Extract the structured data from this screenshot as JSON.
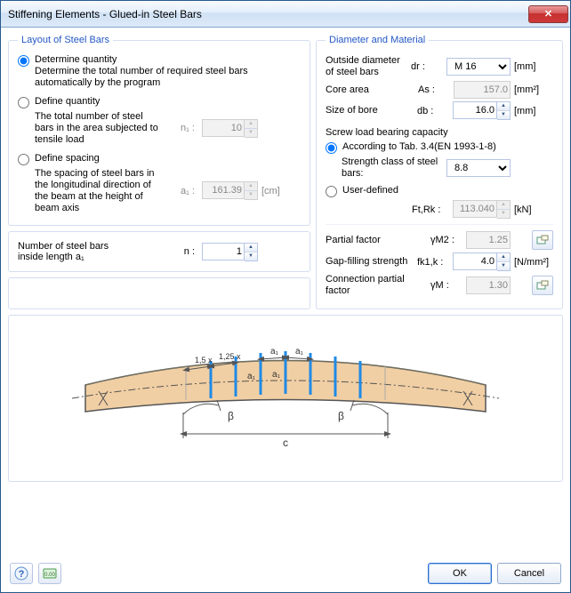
{
  "window": {
    "title": "Stiffening Elements - Glued-in Steel Bars",
    "close_glyph": "✕"
  },
  "layout_group": {
    "legend": "Layout of Steel Bars",
    "opt1": {
      "title": "Determine quantity",
      "desc": "Determine the total number of required steel bars automatically by the program"
    },
    "opt2": {
      "title": "Define quantity",
      "desc": "The total number of steel bars in the area subjected to tensile load",
      "sym": "n₁ :",
      "value": "10"
    },
    "opt3": {
      "title": "Define spacing",
      "desc": "The spacing of steel bars in the longitudinal direction of the beam at the height of beam axis",
      "sym": "a₁ :",
      "value": "161.39",
      "unit": "[cm]"
    },
    "number_group": {
      "label1": "Number of steel bars",
      "label2": "inside length a₁",
      "sym": "n :",
      "value": "1"
    }
  },
  "material_group": {
    "legend": "Diameter and Material",
    "diam": {
      "label": "Outside diameter of steel bars",
      "sym": "dr :",
      "value": "M 16",
      "unit": "[mm]"
    },
    "area": {
      "label": "Core area",
      "sym": "As :",
      "value": "157.0",
      "unit": "[mm²]"
    },
    "bore": {
      "label": "Size of bore",
      "sym": "db :",
      "value": "16.0",
      "unit": "[mm]"
    },
    "cap_label": "Screw load bearing capacity",
    "cap_opt1": "According to Tab. 3.4(EN 1993-1-8)",
    "strength_class": {
      "label": "Strength class of steel bars:",
      "value": "8.8"
    },
    "cap_opt2": "User-defined",
    "ftrk": {
      "sym": "Ft,Rk :",
      "value": "113.040",
      "unit": "[kN]"
    },
    "partial": {
      "label": "Partial factor",
      "sym": "γM2 :",
      "value": "1.25"
    },
    "gap": {
      "label": "Gap-filling strength",
      "sym": "fk1,k :",
      "value": "4.0",
      "unit": "[N/mm²]"
    },
    "conn": {
      "label": "Connection partial factor",
      "sym": "γM :",
      "value": "1.30"
    }
  },
  "diagram": {
    "a1": "a₁",
    "a1b": "a₁",
    "mult15": "1,5 x",
    "mult125": "1,25 x",
    "beta_l": "β",
    "beta_r": "β",
    "c": "c"
  },
  "footer": {
    "ok": "OK",
    "cancel": "Cancel",
    "help": "?",
    "zero": "0.00"
  }
}
